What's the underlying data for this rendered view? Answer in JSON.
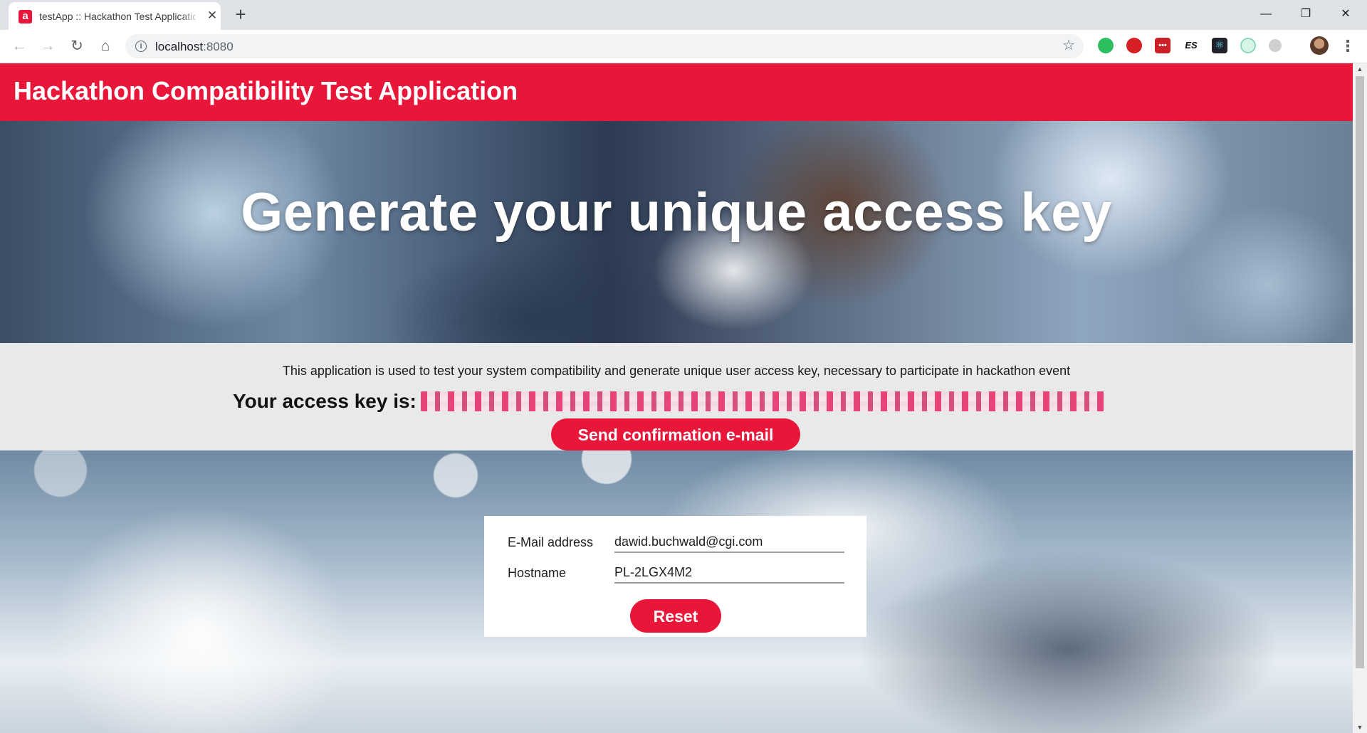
{
  "browser": {
    "tab_title": "testApp :: Hackathon Test Application",
    "favicon_letter": "a",
    "url_host": "localhost",
    "url_port": ":8080",
    "extensions": [
      "evernote-icon",
      "opera-icon",
      "lastpass-icon",
      "es-icon",
      "react-devtools-icon",
      "color-picker-icon",
      "circle-extension-icon"
    ],
    "extension_es_label": "ES"
  },
  "app": {
    "title": "Hackathon Compatibility Test Application",
    "accent_color": "#e8173a"
  },
  "hero": {
    "heading": "Generate your unique access key"
  },
  "info": {
    "description": "This application is used to test your system compatibility and generate unique user access key, necessary to participate in hackathon event",
    "key_label": "Your access key is:",
    "send_button": "Send confirmation e-mail"
  },
  "form": {
    "email_label": "E-Mail address",
    "email_value": "dawid.buchwald@cgi.com",
    "hostname_label": "Hostname",
    "hostname_value": "PL-2LGX4M2",
    "reset_button": "Reset"
  }
}
